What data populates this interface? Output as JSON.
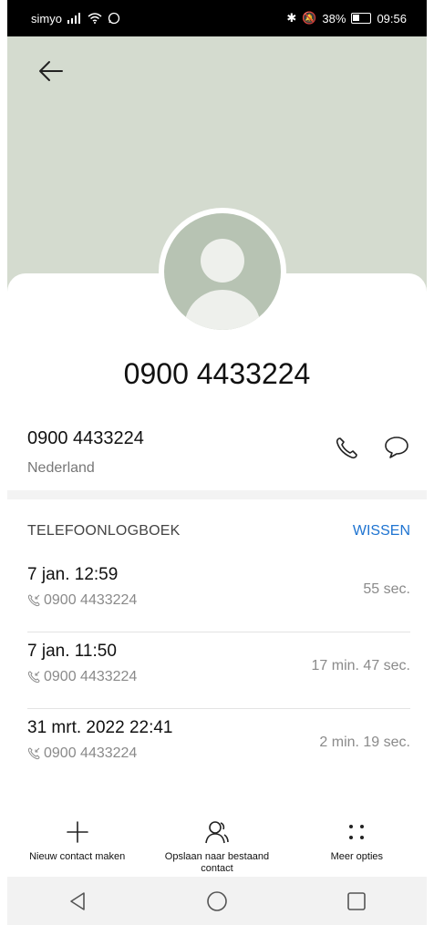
{
  "status": {
    "carrier": "simyo",
    "battery_percent": "38%",
    "time": "09:56"
  },
  "contact": {
    "title": "0900 4433224",
    "number": "0900 4433224",
    "country": "Nederland"
  },
  "log": {
    "title": "TELEFOONLOGBOEK",
    "clear_label": "WISSEN",
    "entries": [
      {
        "date": "7 jan. 12:59",
        "number": "0900 4433224",
        "duration": "55 sec."
      },
      {
        "date": "7 jan. 11:50",
        "number": "0900 4433224",
        "duration": "17 min. 47 sec."
      },
      {
        "date": "31 mrt. 2022 22:41",
        "number": "0900 4433224",
        "duration": "2 min. 19 sec."
      }
    ]
  },
  "actions": {
    "new_contact": "Nieuw contact maken",
    "save_existing": "Opslaan naar bestaand contact",
    "more_options": "Meer opties"
  },
  "colors": {
    "header_bg": "#d4dbcf",
    "accent": "#1f74d1",
    "avatar": "#b7c3b3"
  }
}
